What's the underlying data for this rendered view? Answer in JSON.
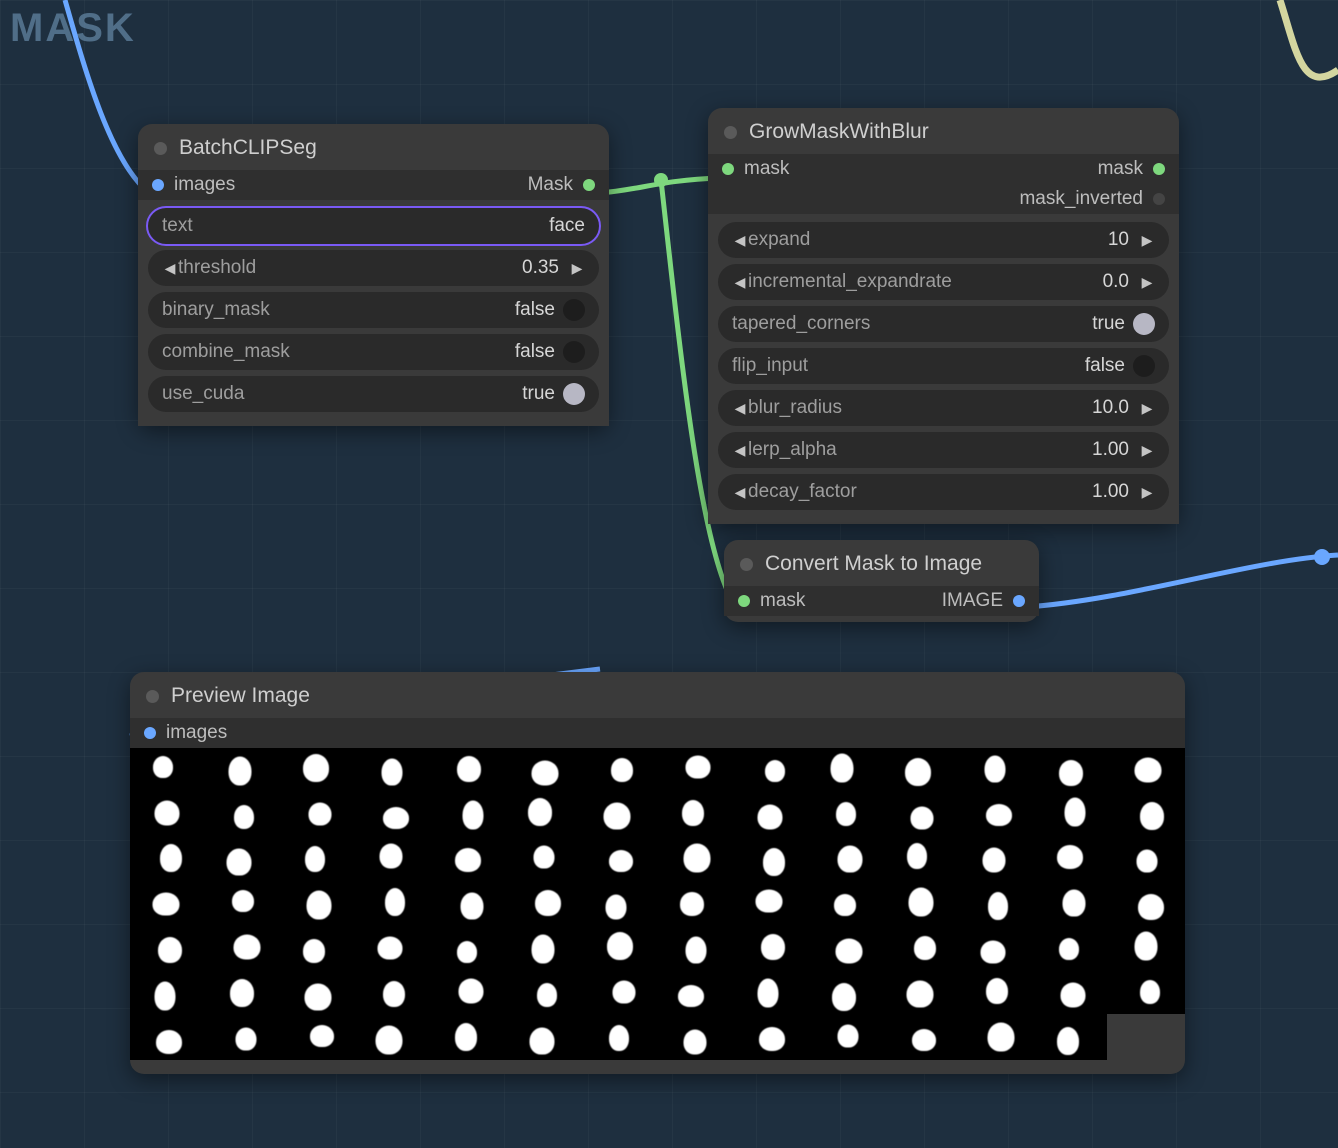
{
  "group_label": "MASK",
  "nodes": {
    "batchclipseg": {
      "title": "BatchCLIPSeg",
      "input_port": "images",
      "output_port": "Mask",
      "widgets": {
        "text": {
          "label": "text",
          "value": "face",
          "highlighted": true
        },
        "threshold": {
          "label": "threshold",
          "value": "0.35"
        },
        "binary_mask": {
          "label": "binary_mask",
          "value": "false"
        },
        "combine_mask": {
          "label": "combine_mask",
          "value": "false"
        },
        "use_cuda": {
          "label": "use_cuda",
          "value": "true"
        }
      }
    },
    "growmask": {
      "title": "GrowMaskWithBlur",
      "input_port": "mask",
      "output_ports": {
        "a": "mask",
        "b": "mask_inverted"
      },
      "widgets": {
        "expand": {
          "label": "expand",
          "value": "10"
        },
        "incremental_expandrate": {
          "label": "incremental_expandrate",
          "value": "0.0"
        },
        "tapered_corners": {
          "label": "tapered_corners",
          "value": "true"
        },
        "flip_input": {
          "label": "flip_input",
          "value": "false"
        },
        "blur_radius": {
          "label": "blur_radius",
          "value": "10.0"
        },
        "lerp_alpha": {
          "label": "lerp_alpha",
          "value": "1.00"
        },
        "decay_factor": {
          "label": "decay_factor",
          "value": "1.00"
        }
      }
    },
    "convert": {
      "title": "Convert Mask to Image",
      "input_port": "mask",
      "output_port": "IMAGE"
    },
    "preview": {
      "title": "Preview Image",
      "input_port": "images",
      "grid": {
        "rows": 7,
        "cols": 14
      }
    }
  },
  "colors": {
    "accent_purple": "#7a5af5",
    "wire_blue": "#6aa7ff",
    "wire_green": "#7ed87e"
  }
}
